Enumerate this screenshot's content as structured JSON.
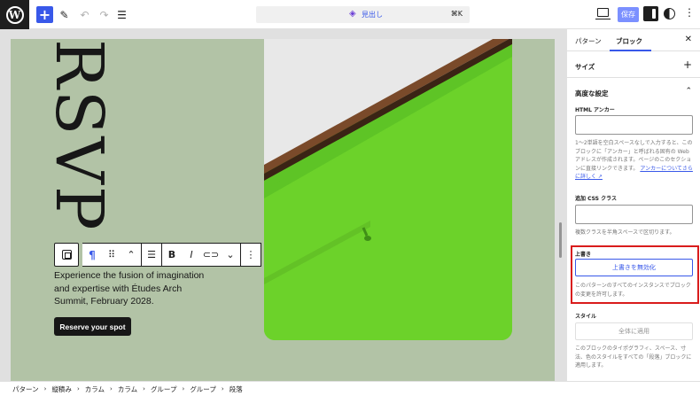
{
  "topbar": {
    "command_label": "見出し",
    "command_shortcut": "⌘K",
    "save_label": "保存"
  },
  "canvas": {
    "heading_text": "RSVP",
    "paragraph_text": "Experience the fusion of imagination and expertise with Études Arch Summit, February 2028.",
    "button_label": "Reserve your spot"
  },
  "sidebar": {
    "tabs": [
      "パターン",
      "ブロック"
    ],
    "sections": {
      "size_title": "サイズ",
      "advanced_title": "高度な設定"
    },
    "html_anchor": {
      "label": "HTML アンカー",
      "value": "",
      "help": "1〜2単語を空白スペースなしで入力すると、このブロックに「アンカー」と呼ばれる固有の Web アドレスが作成されます。ページのこのセクションに直接リンクできます。",
      "help_link": "アンカーについてさらに詳しく ↗"
    },
    "css_class": {
      "label": "追加 CSS クラス",
      "value": "",
      "help": "複数クラスを半角スペースで区切ります。"
    },
    "overrides": {
      "label": "上書き",
      "button_label": "上書きを無効化",
      "help": "このパターンのすべてのインスタンスでブロックの変更を許可します。"
    },
    "style": {
      "label": "スタイル",
      "button_label": "全体に適用",
      "help": "このブロックのタイポグラフィ、スペース、寸法、色のスタイルをすべての「段落」ブロックに適用します。"
    }
  },
  "breadcrumb": [
    "パターン",
    "縦積み",
    "カラム",
    "カラム",
    "グループ",
    "グループ",
    "段落"
  ],
  "colors": {
    "accent": "#3858e9",
    "canvas_bg": "#b2c3a6",
    "highlight_border": "#d91c1c"
  }
}
